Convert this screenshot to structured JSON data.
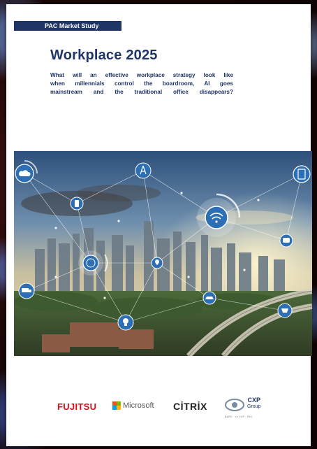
{
  "cover": {
    "tag": "PAC Market Study",
    "title": "Workplace 2025",
    "subtitle_lines": [
      "What will an effective workplace strategy look like",
      "when millennials control the boardroom, AI goes",
      "mainstream and the traditional office disappears?"
    ]
  },
  "hero": {
    "network_icons": [
      "cloud-icon",
      "phone-icon",
      "tower-icon",
      "wifi-icon",
      "globe-icon",
      "lightbulb-icon",
      "tablet-icon",
      "car-icon",
      "chat-icon",
      "truck-icon",
      "pin-icon",
      "cup-icon"
    ]
  },
  "logos": {
    "fujitsu": "FUJITSU",
    "microsoft": "Microsoft",
    "citrix": "CİTRİX",
    "cxp": "CXP",
    "cxp_group": "Group",
    "cxp_sub": "BARC · Le CXP · PAC"
  },
  "colors": {
    "navy": "#1f3566",
    "fujitsu_red": "#d0121b",
    "ms_red": "#f25022",
    "ms_green": "#7fba00",
    "ms_blue": "#00a4ef",
    "ms_yellow": "#ffb900"
  }
}
